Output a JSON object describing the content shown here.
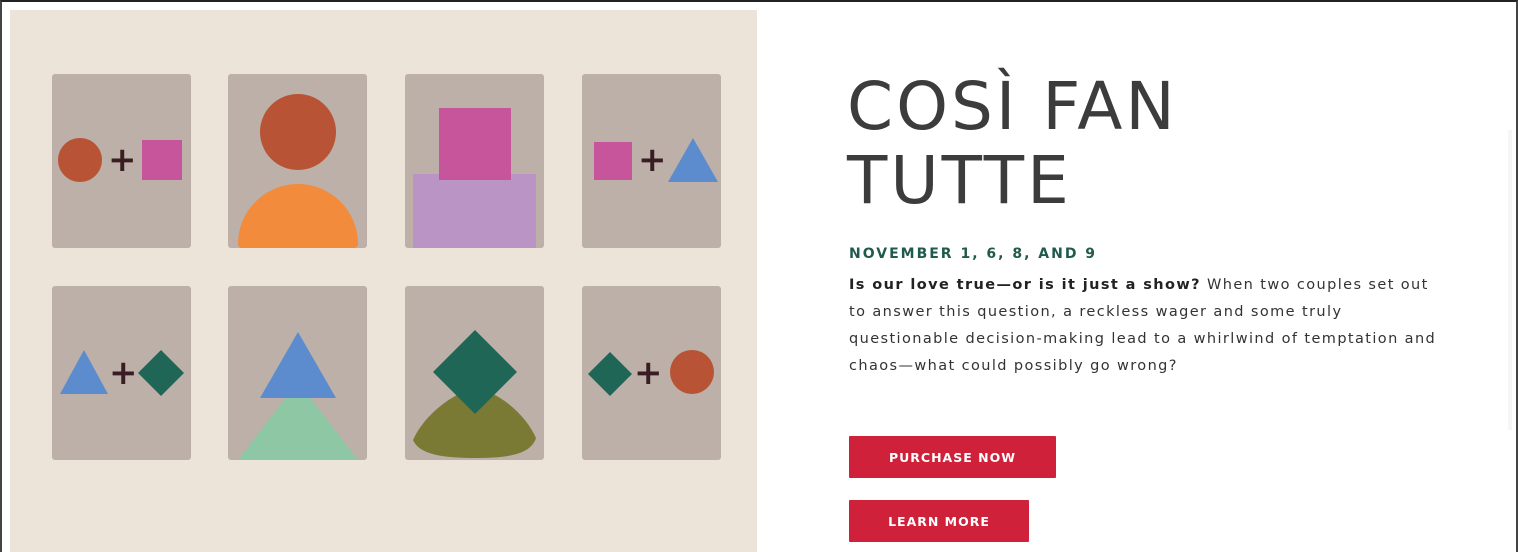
{
  "hero": {
    "title_line1": "COSÌ FAN",
    "title_line2": "TUTTE",
    "dates": "NOVEMBER 1, 6, 8, AND 9",
    "tagline": "Is our love true—or is it just a show?",
    "description": " When two couples set out to answer this question, a reckless wager and some truly questionable decision-making lead to a whirlwind of temptation and chaos—what could possibly go wrong?",
    "purchase_label": "PURCHASE NOW",
    "learn_label": "LEARN MORE"
  },
  "artwork": {
    "plus_symbol": "+"
  },
  "colors": {
    "background_art": "#ede4d9",
    "tile": "#bcb0a8",
    "dates_green": "#1f5a4b",
    "button_red": "#d0213a",
    "rust": "#b85435",
    "orange": "#f28b3b",
    "magenta": "#c6559c",
    "lavender": "#b994c4",
    "blue": "#5c8bce",
    "dark_green": "#1f6656",
    "mint": "#8dc7a4",
    "olive": "#7b7a35"
  }
}
